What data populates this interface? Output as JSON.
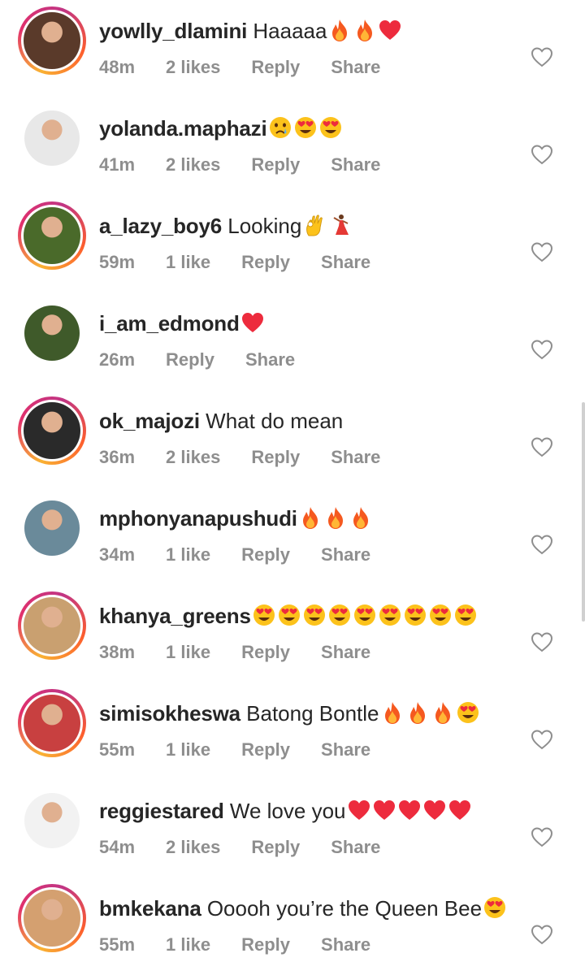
{
  "colors": {
    "text": "#262626",
    "meta": "#8e8e8e",
    "heart": "#ed2b3d",
    "fire": "#f5591f",
    "emoji_face": "#fcc21b"
  },
  "comments": [
    {
      "username": "yowlly_dlamini",
      "text": "Haaaaa",
      "emojis": [
        "fire",
        "fire",
        "red-heart"
      ],
      "time": "48m",
      "likes": "2 likes",
      "reply": "Reply",
      "share": "Share",
      "story_ring": true,
      "avatar_color": "#5a3a2a"
    },
    {
      "username": "yolanda.maphazi",
      "text": "",
      "emojis": [
        "crying-face",
        "heart-eyes",
        "heart-eyes"
      ],
      "time": "41m",
      "likes": "2 likes",
      "reply": "Reply",
      "share": "Share",
      "story_ring": false,
      "avatar_color": "#e8e8e8"
    },
    {
      "username": "a_lazy_boy6",
      "text": "Looking",
      "emojis": [
        "ok-hand",
        "dancer"
      ],
      "time": "59m",
      "likes": "1 like",
      "reply": "Reply",
      "share": "Share",
      "story_ring": true,
      "avatar_color": "#4a6a2a"
    },
    {
      "username": "i_am_edmond",
      "text": "",
      "emojis": [
        "red-heart"
      ],
      "time": "26m",
      "likes": "",
      "reply": "Reply",
      "share": "Share",
      "story_ring": false,
      "avatar_color": "#3f5a2a"
    },
    {
      "username": "ok_majozi",
      "text": "What do mean",
      "emojis": [],
      "time": "36m",
      "likes": "2 likes",
      "reply": "Reply",
      "share": "Share",
      "story_ring": true,
      "avatar_color": "#2a2a2a"
    },
    {
      "username": "mphonyanapushudi",
      "text": "",
      "emojis": [
        "fire",
        "fire",
        "fire"
      ],
      "time": "34m",
      "likes": "1 like",
      "reply": "Reply",
      "share": "Share",
      "story_ring": false,
      "avatar_color": "#6a8a9a"
    },
    {
      "username": "khanya_greens",
      "text": "",
      "emojis": [
        "heart-eyes",
        "heart-eyes",
        "heart-eyes",
        "heart-eyes",
        "heart-eyes",
        "heart-eyes",
        "heart-eyes",
        "heart-eyes",
        "heart-eyes"
      ],
      "time": "38m",
      "likes": "1 like",
      "reply": "Reply",
      "share": "Share",
      "story_ring": true,
      "avatar_color": "#c9a070"
    },
    {
      "username": "simisokheswa",
      "text": "Batong Bontle",
      "emojis": [
        "fire",
        "fire",
        "fire",
        "heart-eyes"
      ],
      "time": "55m",
      "likes": "1 like",
      "reply": "Reply",
      "share": "Share",
      "story_ring": true,
      "avatar_color": "#c84040"
    },
    {
      "username": "reggiestared",
      "text": "We love you",
      "emojis": [
        "red-heart",
        "red-heart",
        "red-heart",
        "red-heart",
        "red-heart"
      ],
      "time": "54m",
      "likes": "2 likes",
      "reply": "Reply",
      "share": "Share",
      "story_ring": false,
      "avatar_color": "#f2f2f2"
    },
    {
      "username": "bmkekana",
      "text": "Ooooh you’re the Queen Bee",
      "emojis": [
        "heart-eyes"
      ],
      "time": "55m",
      "likes": "1 like",
      "reply": "Reply",
      "share": "Share",
      "story_ring": true,
      "avatar_color": "#d4a070"
    }
  ]
}
